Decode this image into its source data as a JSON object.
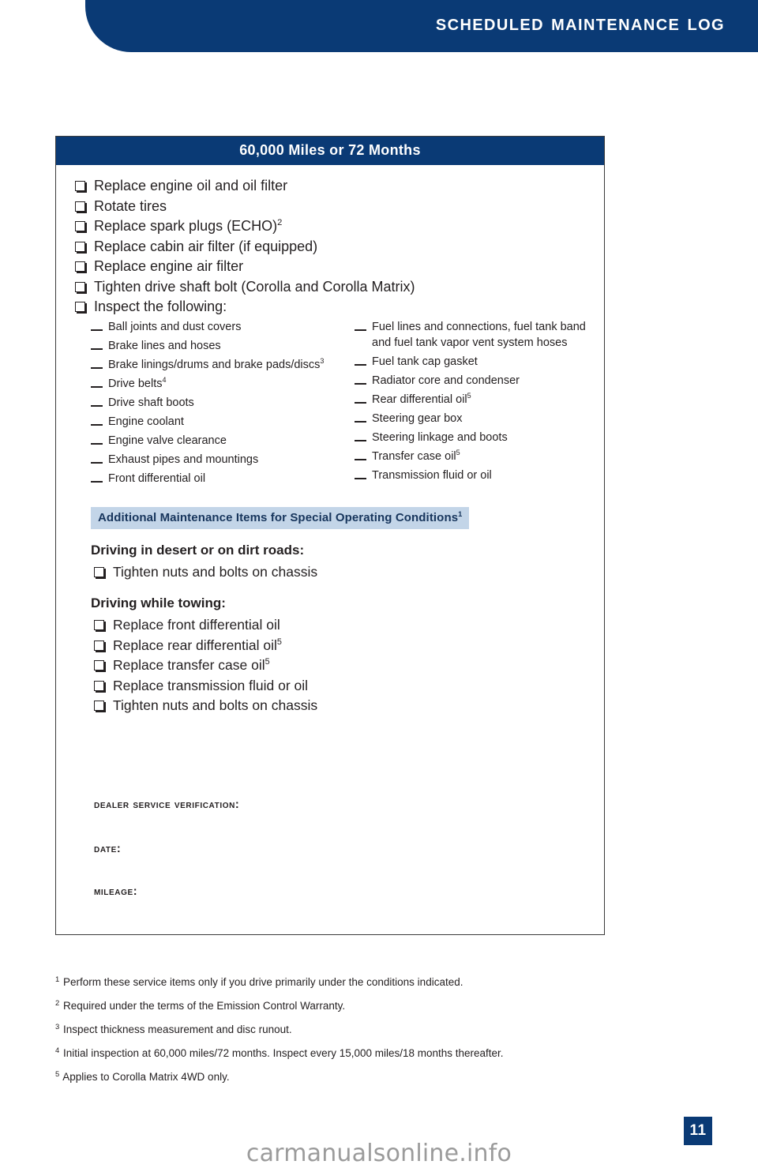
{
  "header": {
    "title": "Scheduled Maintenance Log"
  },
  "box": {
    "title": "60,000 Miles or 72 Months",
    "main_items": [
      {
        "text": "Replace engine oil and oil filter",
        "sup": ""
      },
      {
        "text": "Rotate tires",
        "sup": ""
      },
      {
        "text": "Replace spark plugs (ECHO)",
        "sup": "2"
      },
      {
        "text": "Replace cabin air filter (if equipped)",
        "sup": ""
      },
      {
        "text": "Replace engine air filter",
        "sup": ""
      },
      {
        "text": "Tighten drive shaft bolt (Corolla and Corolla Matrix)",
        "sup": ""
      },
      {
        "text": "Inspect the following:",
        "sup": ""
      }
    ],
    "inspect_left": [
      {
        "text": "Ball joints and dust covers",
        "sup": ""
      },
      {
        "text": "Brake lines and hoses",
        "sup": ""
      },
      {
        "text": "Brake linings/drums and brake pads/discs",
        "sup": "3"
      },
      {
        "text": "Drive belts",
        "sup": "4"
      },
      {
        "text": "Drive shaft boots",
        "sup": ""
      },
      {
        "text": "Engine coolant",
        "sup": ""
      },
      {
        "text": "Engine valve clearance",
        "sup": ""
      },
      {
        "text": "Exhaust pipes and mountings",
        "sup": ""
      },
      {
        "text": "Front differential oil",
        "sup": ""
      }
    ],
    "inspect_right": [
      {
        "text": "Fuel lines and connections, fuel tank band and fuel tank vapor vent system hoses",
        "sup": ""
      },
      {
        "text": "Fuel tank cap gasket",
        "sup": ""
      },
      {
        "text": "Radiator core and condenser",
        "sup": ""
      },
      {
        "text": "Rear differential oil",
        "sup": "5"
      },
      {
        "text": "Steering gear box",
        "sup": ""
      },
      {
        "text": "Steering linkage and boots",
        "sup": ""
      },
      {
        "text": "Transfer case oil",
        "sup": "5"
      },
      {
        "text": "Transmission fluid or oil",
        "sup": ""
      }
    ],
    "additional_band": {
      "text": "Additional Maintenance Items for Special Operating Conditions",
      "sup": "1"
    },
    "desert_heading": "Driving in desert or on dirt roads:",
    "desert_items": [
      {
        "text": "Tighten nuts and bolts on chassis",
        "sup": ""
      }
    ],
    "towing_heading": "Driving while towing:",
    "towing_items": [
      {
        "text": "Replace front differential oil",
        "sup": ""
      },
      {
        "text": "Replace rear differential oil",
        "sup": "5"
      },
      {
        "text": "Replace transfer case oil",
        "sup": "5"
      },
      {
        "text": "Replace transmission fluid or oil",
        "sup": ""
      },
      {
        "text": "Tighten nuts and bolts on chassis",
        "sup": ""
      }
    ],
    "dealer_service_verification_label": "Dealer Service Verification:",
    "date_label": "Date:",
    "mileage_label": "Mileage:"
  },
  "footnotes": [
    {
      "num": "1",
      "text": "Perform these service items only if you drive primarily under the conditions indicated."
    },
    {
      "num": "2",
      "text": "Required under the terms of the Emission Control Warranty."
    },
    {
      "num": "3",
      "text": "Inspect thickness measurement and disc runout."
    },
    {
      "num": "4",
      "text": "Initial inspection at 60,000 miles/72 months. Inspect every 15,000 miles/18 months thereafter."
    },
    {
      "num": "5",
      "text": "Applies to Corolla Matrix 4WD only."
    }
  ],
  "page_number": "11",
  "watermark": "carmanualsonline.info",
  "colors": {
    "navy": "#0a3a75",
    "light_blue_band": "#c3d5e8",
    "text": "#231f20",
    "watermark_gray": "#9b9b9b"
  }
}
